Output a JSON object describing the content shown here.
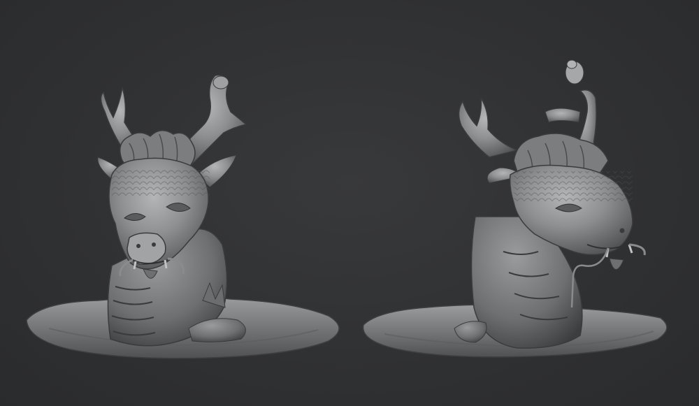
{
  "scene": {
    "background_color": "#303133",
    "clay_color": "#8a8b8d",
    "models": [
      {
        "name": "dragon-bust-front-view",
        "description_icon": "dragon-sculpt"
      },
      {
        "name": "dragon-bust-side-view",
        "description_icon": "dragon-sculpt"
      }
    ]
  }
}
